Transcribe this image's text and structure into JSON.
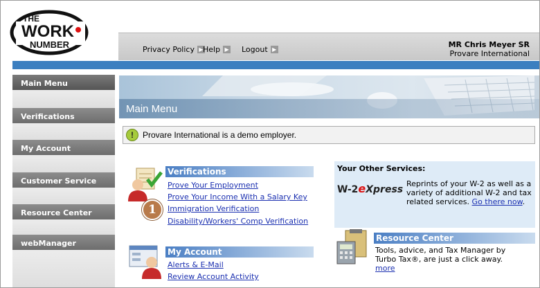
{
  "header": {
    "logo_top": "THE",
    "logo_main": "WORK",
    "logo_bottom": "NUMBER",
    "links": [
      {
        "label": "Privacy Policy"
      },
      {
        "label": "Help"
      },
      {
        "label": "Logout"
      }
    ],
    "user_name": "MR Chris Meyer SR",
    "user_company": "Provare International"
  },
  "sidebar": {
    "items": [
      {
        "label": "Main Menu"
      },
      {
        "label": "Verifications"
      },
      {
        "label": "My Account"
      },
      {
        "label": "Customer Service"
      },
      {
        "label": "Resource Center"
      },
      {
        "label": "webManager"
      }
    ]
  },
  "main": {
    "title": "Main Menu",
    "notice": "Provare International is a demo employer.",
    "verifications": {
      "title": "Verifications",
      "links": [
        "Prove Your Employment",
        "Prove Your Income With a Salary Key",
        "Immigration Verification",
        "Disability/Workers' Comp Verification"
      ]
    },
    "my_account": {
      "title": "My Account",
      "links": [
        "Alerts & E-Mail",
        "Review Account Activity"
      ]
    },
    "other_services": {
      "title": "Your Other Services:",
      "logo_w2": "W-2",
      "logo_e": "e",
      "logo_x": "Xpress",
      "text": "Reprints of your W-2 as well as a variety of additional W-2 and tax related services.",
      "link": "Go there now"
    },
    "resource_center": {
      "title": "Resource Center",
      "text": "Tools, advice, and Tax Manager by Turbo Tax®, are just a click away.",
      "link": "more"
    }
  },
  "step_badge": "1"
}
